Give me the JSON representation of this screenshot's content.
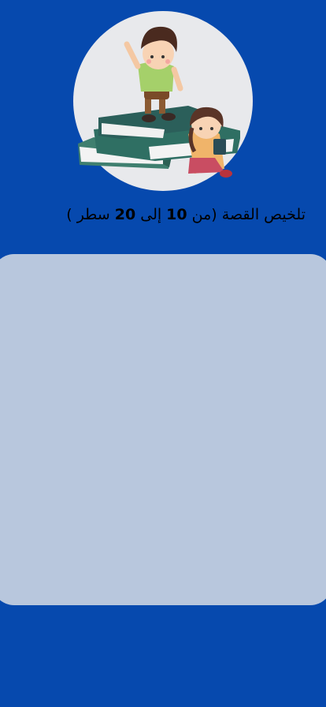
{
  "illustration": {
    "icon": "kids-reading-books-illustration"
  },
  "title": {
    "part1": "تلخيص القصة (من ",
    "num1": "10",
    "part2": "  إلى ",
    "num2": "20",
    "part3": " سطر )"
  },
  "summary": {
    "value": ""
  },
  "colors": {
    "background": "#0649AE",
    "circle": "#E8E9EC",
    "input_box": "#B8C7DD"
  }
}
